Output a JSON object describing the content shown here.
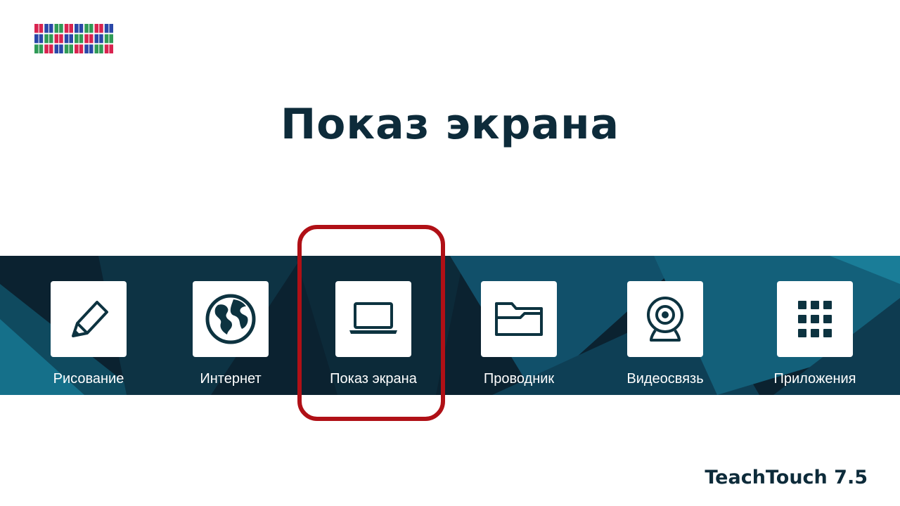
{
  "page": {
    "title": "Показ экрана"
  },
  "brand": {
    "logo_icon": "striped-grid-logo-icon",
    "logo_colors": [
      "#d8234f",
      "#2a47a8",
      "#2f9a56"
    ]
  },
  "dock": {
    "apps": [
      {
        "label": "Рисование",
        "icon": "pencil-icon"
      },
      {
        "label": "Интернет",
        "icon": "globe-icon"
      },
      {
        "label": "Показ экрана",
        "icon": "laptop-icon",
        "highlighted": true
      },
      {
        "label": "Проводник",
        "icon": "folder-icon"
      },
      {
        "label": "Видеосвязь",
        "icon": "webcam-icon"
      },
      {
        "label": "Приложения",
        "icon": "app-grid-icon"
      }
    ]
  },
  "footer": {
    "product": "TeachTouch 7.5"
  },
  "colors": {
    "title": "#0d2b3a",
    "icon": "#0d3340",
    "band_dark": "#0b2230",
    "band_accent": "#13607a",
    "highlight": "#b01016"
  }
}
